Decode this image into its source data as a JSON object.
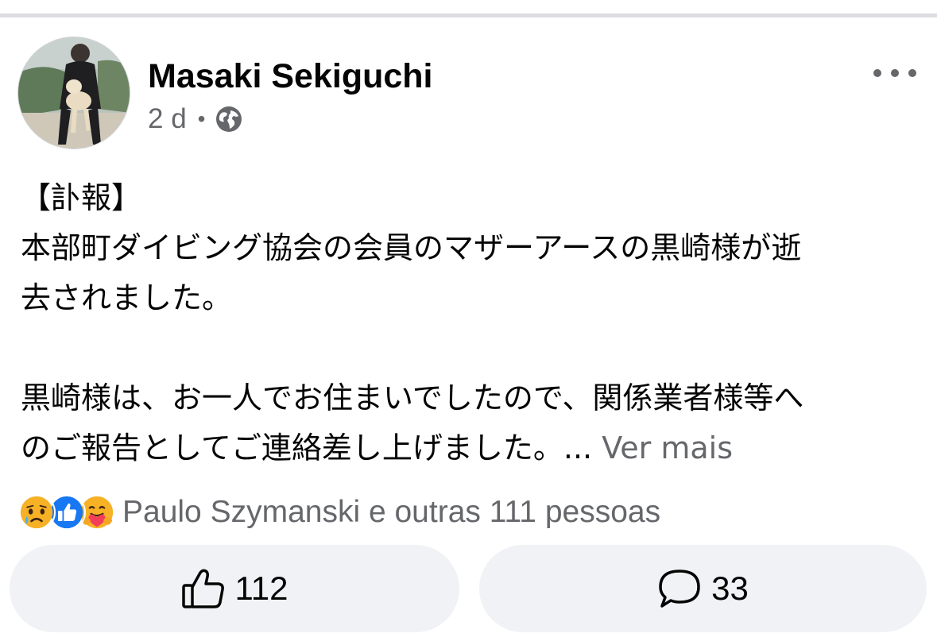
{
  "post": {
    "author": "Masaki Sekiguchi",
    "time": "2 d",
    "separator": "•",
    "privacy_icon": "globe-icon",
    "more_icon": "more-options-icon",
    "lines": [
      "【訃報】",
      "本部町ダイビング協会の会員のマザーアースの黒崎様が逝",
      "去されました。",
      "",
      "黒崎様は、お一人でお住まいでしたので、関係業者様等へ",
      "のご報告としてご連絡差し上げました。..."
    ],
    "see_more": "Ver mais"
  },
  "reactions": {
    "icons": [
      "sad-reaction-icon",
      "like-reaction-icon",
      "care-reaction-icon"
    ],
    "summary": "Paulo Szymanski e outras 111 pessoas"
  },
  "actions": {
    "like_count": "112",
    "comment_count": "33"
  },
  "colors": {
    "secondary_text": "#65676b",
    "button_bg": "#f0f2f5",
    "like_blue": "#1877f2",
    "sad_yellow": "#f7b125",
    "care_red": "#f33e58"
  }
}
